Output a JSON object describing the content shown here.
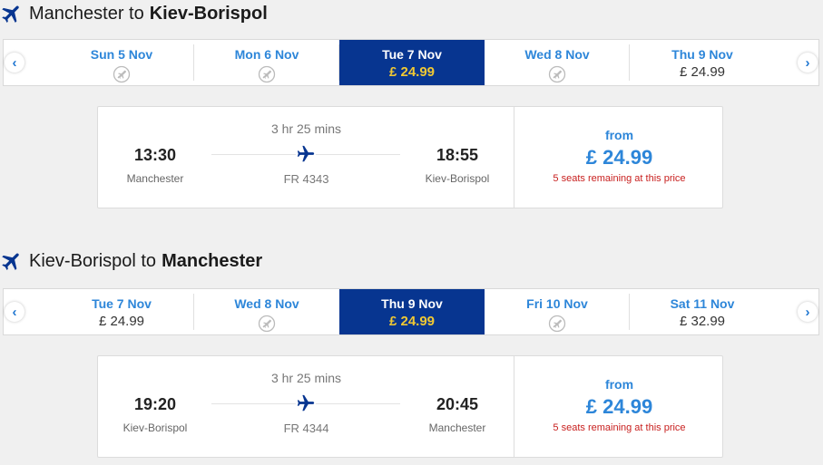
{
  "outbound": {
    "title_from": "Manchester to",
    "title_to": "Kiev-Borispol",
    "prev_label": "‹",
    "next_label": "›",
    "dates": [
      {
        "label": "Sun 5 Nov",
        "price": null
      },
      {
        "label": "Mon 6 Nov",
        "price": null
      },
      {
        "label": "Tue 7 Nov",
        "price": "£ 24.99",
        "selected": true
      },
      {
        "label": "Wed 8 Nov",
        "price": null
      },
      {
        "label": "Thu 9 Nov",
        "price": "£ 24.99"
      }
    ],
    "flight": {
      "duration": "3 hr 25 mins",
      "depart_time": "13:30",
      "depart_city": "Manchester",
      "arrive_time": "18:55",
      "arrive_city": "Kiev-Borispol",
      "flight_number": "FR 4343",
      "from_label": "from",
      "price": "£ 24.99",
      "seats": "5 seats remaining at this price"
    }
  },
  "return": {
    "title_from": "Kiev-Borispol to",
    "title_to": "Manchester",
    "prev_label": "‹",
    "next_label": "›",
    "dates": [
      {
        "label": "Tue 7 Nov",
        "price": "£ 24.99"
      },
      {
        "label": "Wed 8 Nov",
        "price": null
      },
      {
        "label": "Thu 9 Nov",
        "price": "£ 24.99",
        "selected": true
      },
      {
        "label": "Fri 10 Nov",
        "price": null
      },
      {
        "label": "Sat 11 Nov",
        "price": "£ 32.99"
      }
    ],
    "flight": {
      "duration": "3 hr 25 mins",
      "depart_time": "19:20",
      "depart_city": "Kiev-Borispol",
      "arrive_time": "20:45",
      "arrive_city": "Manchester",
      "flight_number": "FR 4344",
      "from_label": "from",
      "price": "£ 24.99",
      "seats": "5 seats remaining at this price"
    }
  },
  "icons": {
    "plane": "plane-icon",
    "no_flight": "no-flights-icon",
    "chevron_left": "chevron-left-icon",
    "chevron_right": "chevron-right-icon"
  },
  "colors": {
    "brand_blue": "#073590",
    "link_blue": "#2d86d9",
    "price_yellow": "#f1c933",
    "warning_red": "#c8201f"
  }
}
